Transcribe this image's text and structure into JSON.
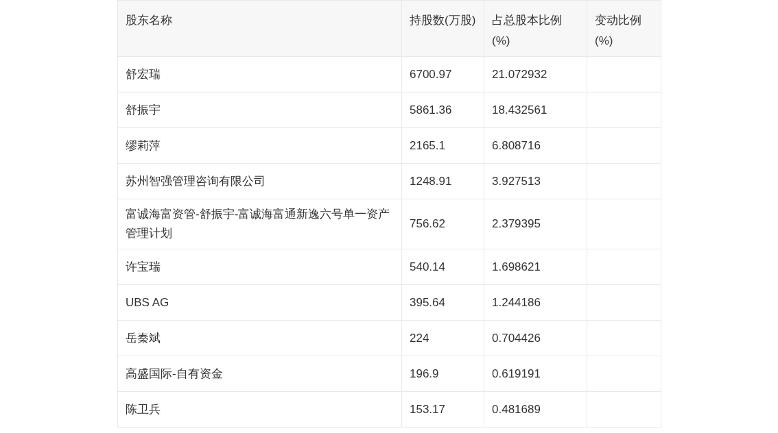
{
  "table": {
    "columns": [
      "股东名称",
      "持股数(万股)",
      "占总股本比例(%)",
      "变动比例(%)"
    ],
    "rows": [
      [
        "舒宏瑞",
        "6700.97",
        "21.072932",
        ""
      ],
      [
        "舒振宇",
        "5861.36",
        "18.432561",
        ""
      ],
      [
        "缪莉萍",
        "2165.1",
        "6.808716",
        ""
      ],
      [
        "苏州智强管理咨询有限公司",
        "1248.91",
        "3.927513",
        ""
      ],
      [
        "富诚海富资管-舒振宇-富诚海富通新逸六号单一资产管理计划",
        "756.62",
        "2.379395",
        ""
      ],
      [
        "许宝瑞",
        "540.14",
        "1.698621",
        ""
      ],
      [
        "UBS AG",
        "395.64",
        "1.244186",
        ""
      ],
      [
        "岳秦斌",
        "224",
        "0.704426",
        ""
      ],
      [
        "高盛国际-自有资金",
        "196.9",
        "0.619191",
        ""
      ],
      [
        "陈卫兵",
        "153.17",
        "0.481689",
        ""
      ]
    ]
  }
}
